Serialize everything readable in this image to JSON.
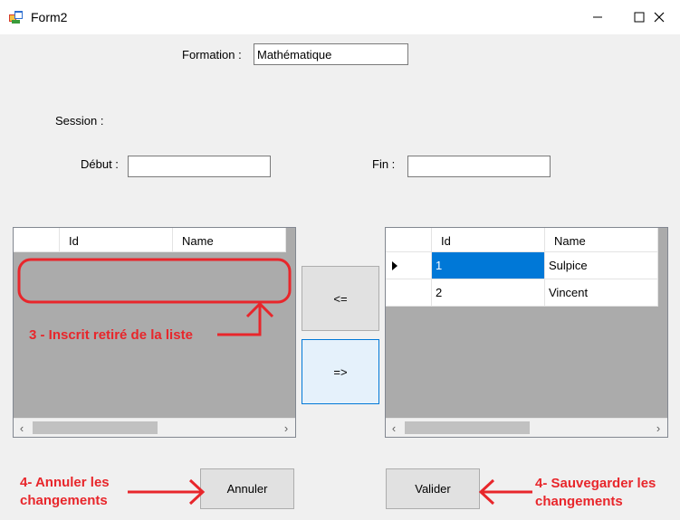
{
  "window": {
    "title": "Form2",
    "controls": [
      "minimize-icon",
      "maximize-icon",
      "close-icon"
    ]
  },
  "form": {
    "formation_label": "Formation :",
    "formation_value": "Mathématique",
    "session_label": "Session :",
    "debut_label": "Début :",
    "debut_value": "",
    "fin_label": "Fin :",
    "fin_value": ""
  },
  "left_grid": {
    "columns": [
      "Id",
      "Name"
    ],
    "rows": []
  },
  "right_grid": {
    "columns": [
      "Id",
      "Name"
    ],
    "rows": [
      {
        "id": "1",
        "name": "Sulpice",
        "selected": true
      },
      {
        "id": "2",
        "name": "Vincent",
        "selected": false
      }
    ]
  },
  "transfer": {
    "move_left_label": "<=",
    "move_right_label": "=>"
  },
  "actions": {
    "cancel_label": "Annuler",
    "validate_label": "Valider"
  },
  "annotations": {
    "removed": "3 - Inscrit retiré de la liste",
    "cancel_line1": "4- Annuler les",
    "cancel_line2": "changements",
    "save_line1": "4- Sauvegarder les",
    "save_line2": "changements",
    "color": "#e8262b"
  },
  "colors": {
    "selection": "#0078d7",
    "grid_background": "#ababab",
    "form_background": "#f0f0f0"
  }
}
